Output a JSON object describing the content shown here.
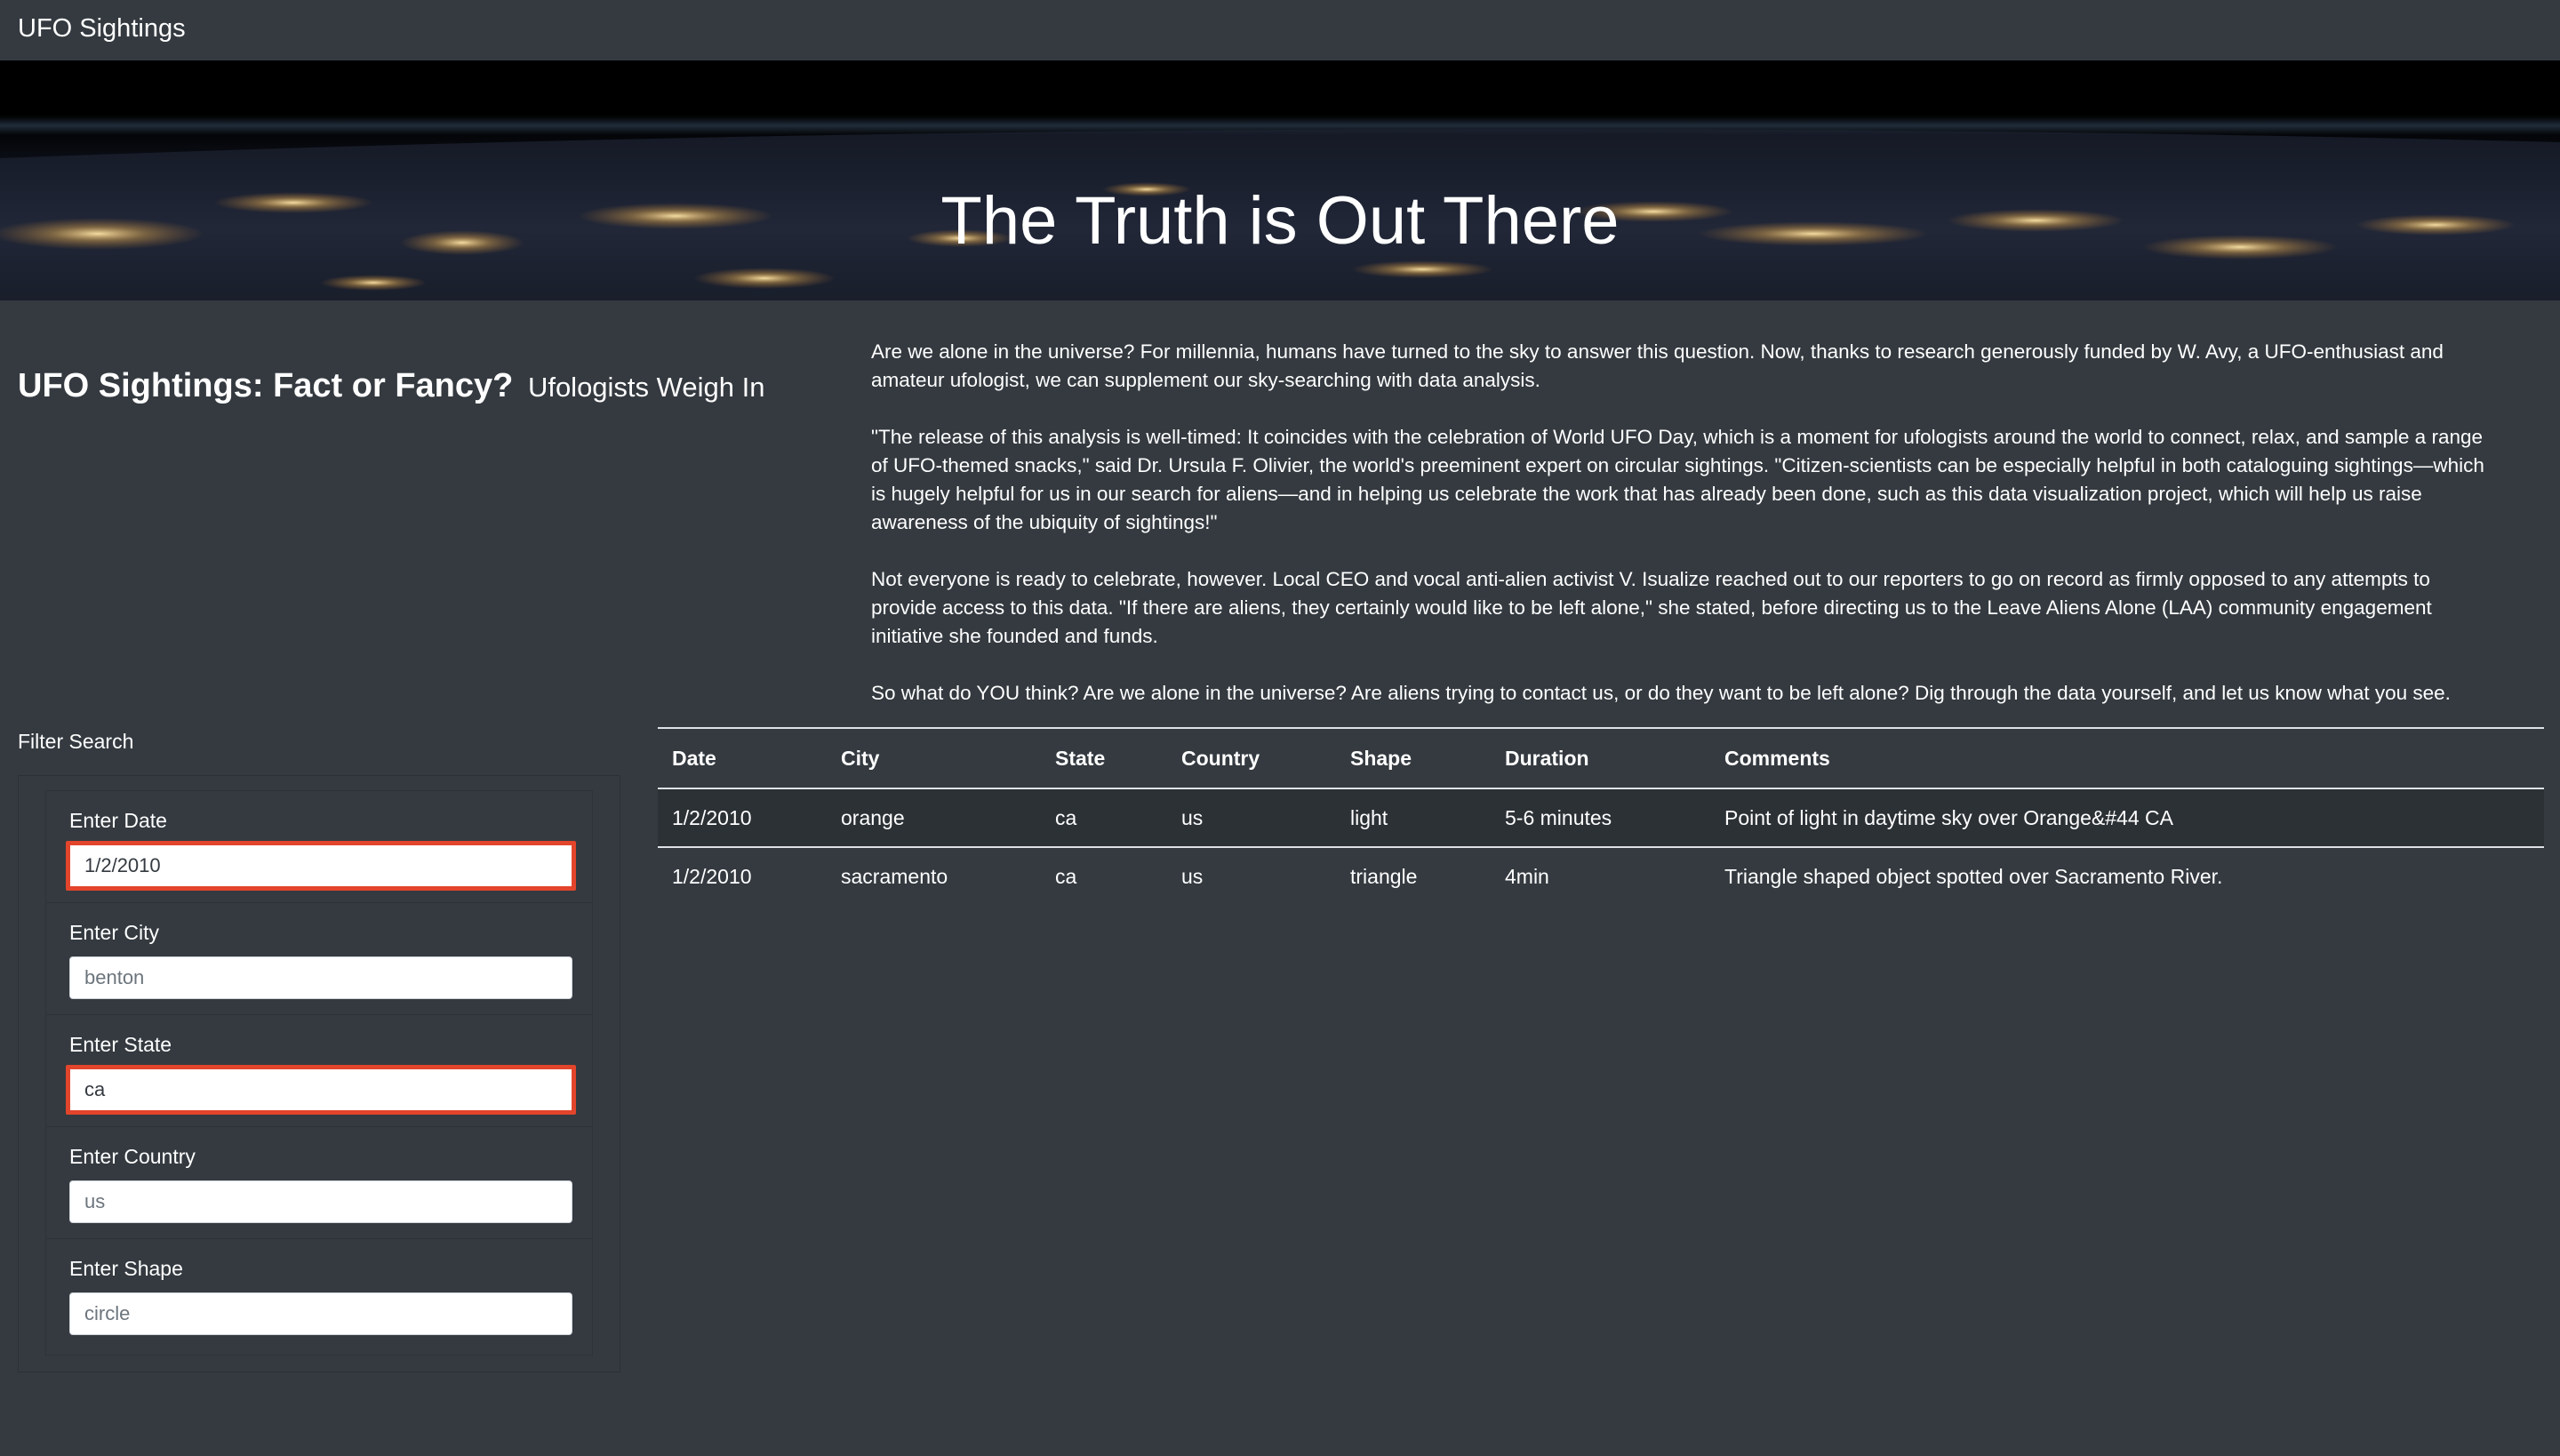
{
  "navbar": {
    "brand": "UFO Sightings"
  },
  "hero": {
    "title": "The Truth is Out There"
  },
  "intro": {
    "heading": "UFO Sightings: Fact or Fancy?",
    "subheading": "Ufologists Weigh In",
    "paragraphs": [
      "Are we alone in the universe? For millennia, humans have turned to the sky to answer this question. Now, thanks to research generously funded by W. Avy, a UFO-enthusiast and amateur ufologist, we can supplement our sky-searching with data analysis.",
      "\"The release of this analysis is well-timed: It coincides with the celebration of World UFO Day, which is a moment for ufologists around the world to connect, relax, and sample a range of UFO-themed snacks,\" said Dr. Ursula F. Olivier, the world's preeminent expert on circular sightings. \"Citizen-scientists can be especially helpful in both cataloguing sightings—which is hugely helpful for us in our search for aliens—and in helping us celebrate the work that has already been done, such as this data visualization project, which will help us raise awareness of the ubiquity of sightings!\"",
      "Not everyone is ready to celebrate, however. Local CEO and vocal anti-alien activist V. Isualize reached out to our reporters to go on record as firmly opposed to any attempts to provide access to this data. \"If there are aliens, they certainly would like to be left alone,\" she stated, before directing us to the Leave Aliens Alone (LAA) community engagement initiative she founded and funds.",
      "So what do YOU think? Are we alone in the universe? Are aliens trying to contact us, or do they want to be left alone? Dig through the data yourself, and let us know what you see."
    ]
  },
  "filters": {
    "title": "Filter Search",
    "date": {
      "label": "Enter Date",
      "value": "1/2/2010",
      "placeholder": ""
    },
    "city": {
      "label": "Enter City",
      "value": "",
      "placeholder": "benton"
    },
    "state": {
      "label": "Enter State",
      "value": "ca",
      "placeholder": ""
    },
    "country": {
      "label": "Enter Country",
      "value": "",
      "placeholder": "us"
    },
    "shape": {
      "label": "Enter Shape",
      "value": "",
      "placeholder": "circle"
    },
    "highlight_color": "#e2452b"
  },
  "table": {
    "headers": [
      "Date",
      "City",
      "State",
      "Country",
      "Shape",
      "Duration",
      "Comments"
    ],
    "rows": [
      [
        "1/2/2010",
        "orange",
        "ca",
        "us",
        "light",
        "5-6 minutes",
        "Point of light in daytime sky over Orange&#44 CA"
      ],
      [
        "1/2/2010",
        "sacramento",
        "ca",
        "us",
        "triangle",
        "4min",
        "Triangle shaped object spotted over Sacramento River."
      ]
    ]
  },
  "colors": {
    "background": "#343a40",
    "text": "#ffffff",
    "input_border": "#ced4da"
  }
}
